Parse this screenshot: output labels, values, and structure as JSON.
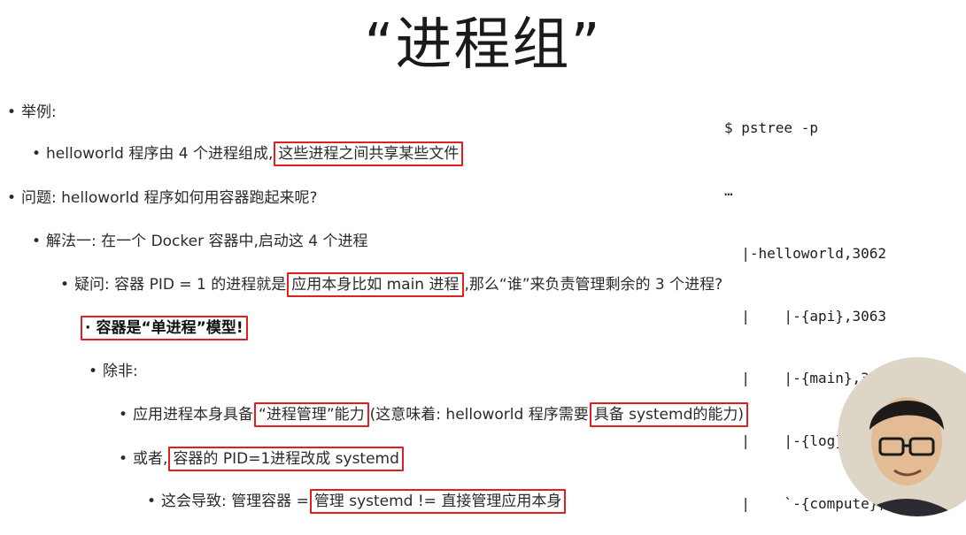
{
  "slide": {
    "title": "“进程组”",
    "bullets": {
      "l1": "举例:",
      "l2a": "helloworld 程序由 4 个进程组成,",
      "l2b": "这些进程之间共享某些文件",
      "l3": "问题: helloworld 程序如何用容器跑起来呢?",
      "l4": "解法一: 在一个 Docker 容器中,启动这 4 个进程",
      "l5a": "疑问: 容器 PID = 1 的进程就是",
      "l5b": "应用本身比如 main 进程",
      "l5c": ",那么“谁”来负责管理剩余的 3 个进程?",
      "l6": "容器是“单进程”模型!",
      "l7": "除非:",
      "l8a": "应用进程本身具备",
      "l8b": "“进程管理”能力",
      "l8c": "(这意味着: helloworld 程序需要",
      "l8d": "具备 systemd的能力)",
      "l9a": "或者,",
      "l9b": "容器的 PID=1进程改成 systemd",
      "l10a": "这会导致: 管理容器 =",
      "l10b": "管理 systemd != 直接管理应用本身"
    },
    "code": {
      "lines": [
        "$ pstree -p",
        "…",
        "  |-helloworld,3062",
        "  |    |-{api},3063",
        "  |    |-{main},3064",
        "  |    |-{log},3065",
        "  |    `-{compute},3133"
      ]
    }
  },
  "colors": {
    "highlight_border": "#e02020",
    "background": "#ffffff"
  }
}
